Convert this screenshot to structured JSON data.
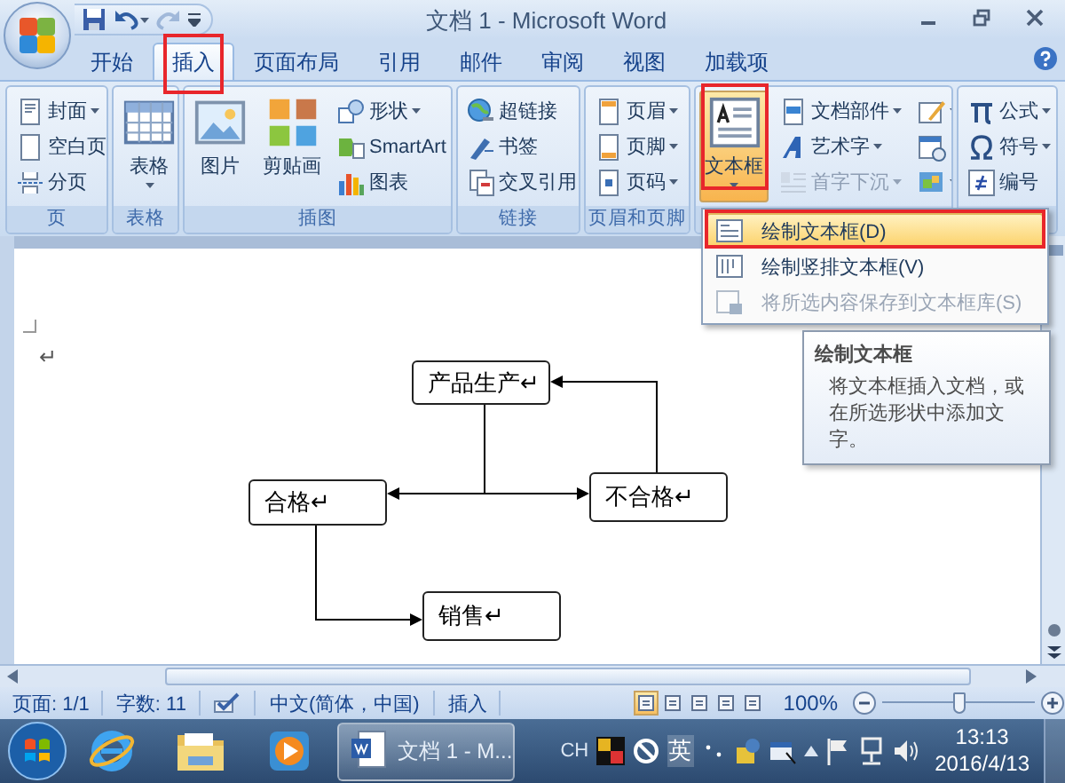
{
  "window": {
    "title": "文档 1 - Microsoft Word"
  },
  "quick_access": [
    {
      "disabled": false
    },
    {
      "disabled": false
    },
    {
      "disabled": true
    },
    {
      "disabled": false
    }
  ],
  "tabs": [
    {
      "label": "开始",
      "selected": false
    },
    {
      "label": "插入",
      "selected": true
    },
    {
      "label": "页面布局",
      "selected": false
    },
    {
      "label": "引用",
      "selected": false
    },
    {
      "label": "邮件",
      "selected": false
    },
    {
      "label": "审阅",
      "selected": false
    },
    {
      "label": "视图",
      "selected": false
    },
    {
      "label": "加载项",
      "selected": false
    }
  ],
  "ribbon": {
    "groups": [
      {
        "label": "页",
        "items": [
          {
            "kind": "small",
            "label": "封面",
            "dropdown": true,
            "disabled": false,
            "expanded": false
          },
          {
            "kind": "small",
            "label": "空白页",
            "dropdown": false,
            "disabled": false,
            "expanded": false
          },
          {
            "kind": "small",
            "label": "分页",
            "dropdown": false,
            "disabled": false,
            "expanded": false
          }
        ]
      },
      {
        "label": "表格",
        "items": [
          {
            "kind": "large",
            "label": "表格",
            "dropdown": true,
            "disabled": false,
            "expanded": false
          }
        ]
      },
      {
        "label": "插图",
        "items": [
          {
            "kind": "large",
            "label": "图片",
            "dropdown": false,
            "disabled": false,
            "expanded": false
          },
          {
            "kind": "large",
            "label": "剪贴画",
            "dropdown": false,
            "disabled": false,
            "expanded": false
          },
          {
            "kind": "small",
            "label": "形状",
            "dropdown": true,
            "disabled": false,
            "expanded": false
          },
          {
            "kind": "small",
            "label": "SmartArt",
            "dropdown": false,
            "disabled": false,
            "expanded": false
          },
          {
            "kind": "small",
            "label": "图表",
            "dropdown": false,
            "disabled": false,
            "expanded": false
          }
        ]
      },
      {
        "label": "链接",
        "items": [
          {
            "kind": "small",
            "label": "超链接",
            "dropdown": false,
            "disabled": false,
            "expanded": false
          },
          {
            "kind": "small",
            "label": "书签",
            "dropdown": false,
            "disabled": false,
            "expanded": false
          },
          {
            "kind": "small",
            "label": "交叉引用",
            "dropdown": false,
            "disabled": false,
            "expanded": false
          }
        ]
      },
      {
        "label": "页眉和页脚",
        "items": [
          {
            "kind": "small",
            "label": "页眉",
            "dropdown": true,
            "disabled": false,
            "expanded": false
          },
          {
            "kind": "small",
            "label": "页脚",
            "dropdown": true,
            "disabled": false,
            "expanded": false
          },
          {
            "kind": "small",
            "label": "页码",
            "dropdown": true,
            "disabled": false,
            "expanded": false
          }
        ]
      },
      {
        "items": [
          {
            "kind": "large",
            "label": "文本框",
            "dropdown": true,
            "disabled": false,
            "expanded": true
          },
          {
            "kind": "small",
            "label": "文档部件",
            "dropdown": true,
            "disabled": false,
            "expanded": false
          },
          {
            "kind": "small",
            "label": "艺术字",
            "dropdown": true,
            "disabled": false,
            "expanded": false
          },
          {
            "kind": "small",
            "label": "首字下沉",
            "dropdown": true,
            "disabled": true,
            "expanded": false
          },
          {
            "kind": "icon",
            "dropdown": true,
            "disabled": false,
            "expanded": false
          },
          {
            "kind": "icon",
            "dropdown": false,
            "disabled": false,
            "expanded": false
          },
          {
            "kind": "icon",
            "dropdown": true,
            "disabled": false,
            "expanded": false
          }
        ]
      },
      {
        "items": [
          {
            "kind": "small",
            "label": "公式",
            "dropdown": true,
            "disabled": false,
            "expanded": false
          },
          {
            "kind": "small",
            "label": "符号",
            "dropdown": true,
            "disabled": false,
            "expanded": false
          },
          {
            "kind": "small",
            "label": "编号",
            "dropdown": false,
            "disabled": false,
            "expanded": false
          }
        ]
      }
    ]
  },
  "document": {
    "paragraph_mark": "↵",
    "boxes": [
      {
        "text": "产品生产↵"
      },
      {
        "text": "合格↵"
      },
      {
        "text": "不合格↵"
      },
      {
        "text": "销售↵"
      }
    ]
  },
  "menu": {
    "items": [
      {
        "label": "绘制文本框(D)",
        "selected": true,
        "disabled": false
      },
      {
        "label": "绘制竖排文本框(V)",
        "selected": false,
        "disabled": false
      },
      {
        "label": "将所选内容保存到文本框库(S)",
        "selected": false,
        "disabled": true
      }
    ]
  },
  "tooltip": {
    "title": "绘制文本框",
    "text": "将文本框插入文档，或在所选形状中添加文字。"
  },
  "annotation_frames": [
    {
      "kind": "tab"
    },
    {
      "kind": "button"
    },
    {
      "kind": "menu-item"
    }
  ],
  "status_bar": {
    "page": "页面: 1/1",
    "words": "字数: 11",
    "language": "中文(简体，中国)",
    "mode": "插入",
    "views": [
      {
        "selected": true
      },
      {
        "selected": false
      },
      {
        "selected": false
      },
      {
        "selected": false
      },
      {
        "selected": false
      }
    ],
    "zoom": {
      "reading": "100%",
      "level": 0.5
    }
  },
  "taskbar": {
    "task": "文档 1 - M...",
    "language": "CH",
    "input_mode": "英",
    "time": "13:13",
    "date": "2016/4/13"
  }
}
